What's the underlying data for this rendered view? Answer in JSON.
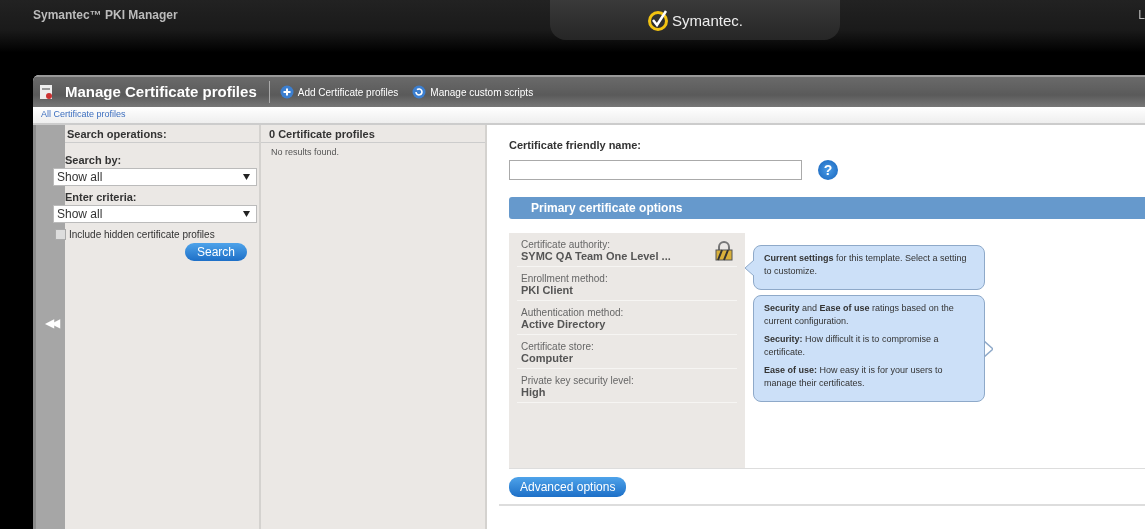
{
  "app_bar": {
    "title": "Symantec™ PKI Manager",
    "brand": "Symantec.",
    "cut_text": "L"
  },
  "window": {
    "title": "Manage Certificate profiles",
    "actions": [
      {
        "label": "Add Certificate profiles",
        "kind": "add"
      },
      {
        "label": "Manage custom scripts",
        "kind": "refresh"
      }
    ],
    "breadcrumb": "All Certificate profiles"
  },
  "search_panel": {
    "heading": "Search operations:",
    "fields": [
      {
        "label": "Search by:",
        "value": "Show all"
      },
      {
        "label": "Enter criteria:",
        "value": "Show all"
      }
    ],
    "include_hidden": {
      "label": "Include hidden certificate profiles",
      "checked": false
    },
    "button": "Search",
    "collapse": "◀◀"
  },
  "results_panel": {
    "heading": "0 Certificate profiles",
    "message": "No results found."
  },
  "detail": {
    "name_label": "Certificate friendly name:",
    "help": "?",
    "section": "Primary certificate options",
    "settings": [
      {
        "label": "Certificate authority:",
        "value": "SYMC QA Team One Level ...",
        "locked": true
      },
      {
        "label": "Enrollment method:",
        "value": "PKI Client",
        "locked": false
      },
      {
        "label": "Authentication method:",
        "value": "Active Directory",
        "locked": false
      },
      {
        "label": "Certificate store:",
        "value": "Computer",
        "locked": false
      },
      {
        "label": "Private key security level:",
        "value": "High",
        "locked": false
      }
    ],
    "tips": [
      {
        "paragraphs": [
          "**Current settings** for this template. Select a setting to customize."
        ],
        "kind": "left-pointer"
      },
      {
        "paragraphs": [
          "**Security** and **Ease of use** ratings based on the current configuration.",
          "**Security:** How difficult it is to compromise a certificate.",
          "**Ease of use:** How easy it is for your users to manage their certificates."
        ],
        "kind": "right-pointer"
      }
    ],
    "advanced_button": "Advanced options"
  }
}
